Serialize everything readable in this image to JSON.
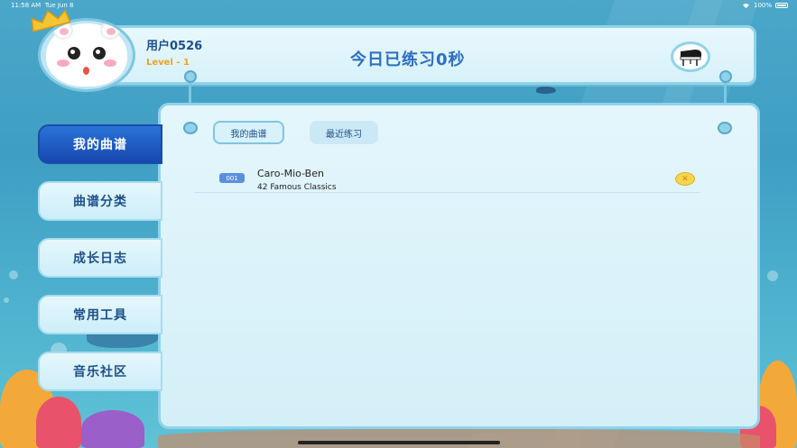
{
  "status_bar": {
    "time": "11:58 AM",
    "date": "Tue Jun 8",
    "battery": "100%"
  },
  "header": {
    "username": "用户0526",
    "level": "Level - 1",
    "practice_today": "今日已练习0秒"
  },
  "nav": {
    "items": [
      {
        "label": "我的曲谱",
        "active": true
      },
      {
        "label": "曲谱分类",
        "active": false
      },
      {
        "label": "成长日志",
        "active": false
      },
      {
        "label": "常用工具",
        "active": false
      },
      {
        "label": "音乐社区",
        "active": false
      }
    ]
  },
  "tabs": [
    {
      "label": "我的曲谱",
      "active": true
    },
    {
      "label": "最近练习",
      "active": false
    }
  ],
  "songs": [
    {
      "number": "001",
      "title": "Caro-Mio-Ben",
      "collection": "42 Famous Classics"
    }
  ],
  "icons": {
    "avatar": "hamster-avatar",
    "crown": "crown-icon",
    "piano": "grand-piano-icon",
    "remove": "close-icon",
    "wifi": "wifi-icon",
    "battery": "battery-icon"
  },
  "colors": {
    "nav_active": "#1748b0",
    "title_blue": "#2c6fc1",
    "level_orange": "#f0a020",
    "badge_blue": "#5b8fe0",
    "remove_yellow": "#f7d54a"
  }
}
